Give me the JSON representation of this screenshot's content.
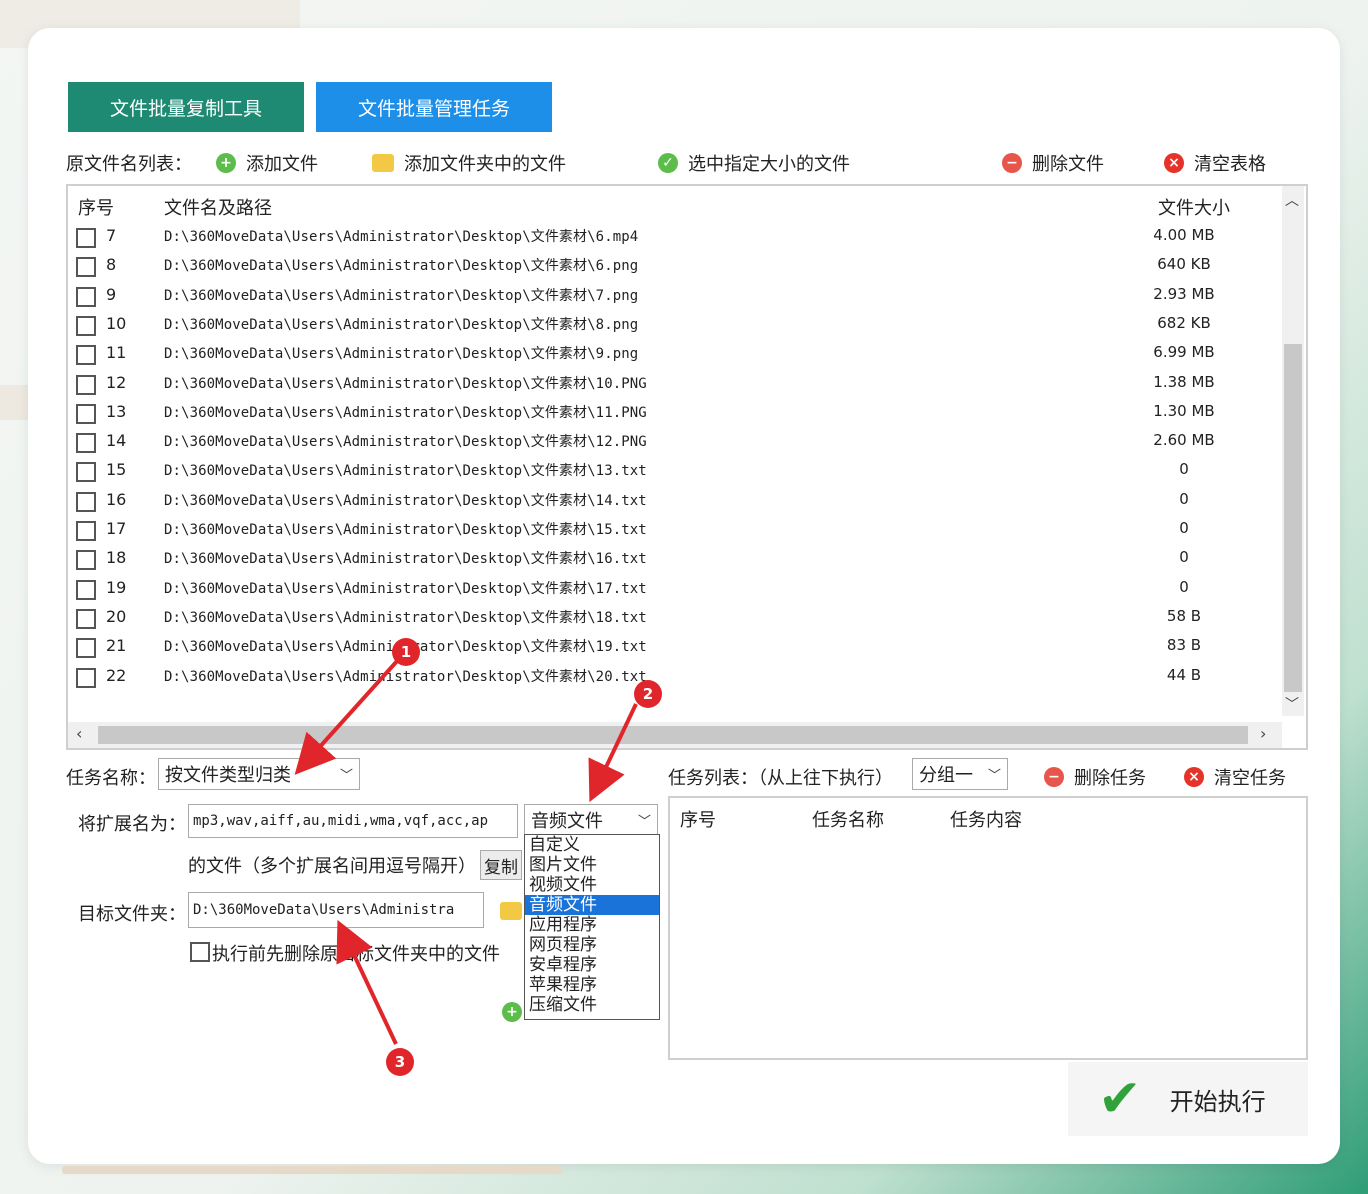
{
  "tabs": [
    "文件批量复制工具",
    "文件批量管理任务"
  ],
  "toolbar": {
    "label": "原文件名列表：",
    "add_file": "添加文件",
    "add_folder_files": "添加文件夹中的文件",
    "select_by_size": "选中指定大小的文件",
    "delete_file": "删除文件",
    "clear_table": "清空表格"
  },
  "file_table": {
    "headers": [
      "序号",
      "文件名及路径",
      "文件大小"
    ],
    "rows": [
      {
        "num": "7",
        "path": "D:\\360MoveData\\Users\\Administrator\\Desktop\\文件素材\\6.mp4",
        "size": "4.00 MB"
      },
      {
        "num": "8",
        "path": "D:\\360MoveData\\Users\\Administrator\\Desktop\\文件素材\\6.png",
        "size": "640 KB"
      },
      {
        "num": "9",
        "path": "D:\\360MoveData\\Users\\Administrator\\Desktop\\文件素材\\7.png",
        "size": "2.93 MB"
      },
      {
        "num": "10",
        "path": "D:\\360MoveData\\Users\\Administrator\\Desktop\\文件素材\\8.png",
        "size": "682 KB"
      },
      {
        "num": "11",
        "path": "D:\\360MoveData\\Users\\Administrator\\Desktop\\文件素材\\9.png",
        "size": "6.99 MB"
      },
      {
        "num": "12",
        "path": "D:\\360MoveData\\Users\\Administrator\\Desktop\\文件素材\\10.PNG",
        "size": "1.38 MB"
      },
      {
        "num": "13",
        "path": "D:\\360MoveData\\Users\\Administrator\\Desktop\\文件素材\\11.PNG",
        "size": "1.30 MB"
      },
      {
        "num": "14",
        "path": "D:\\360MoveData\\Users\\Administrator\\Desktop\\文件素材\\12.PNG",
        "size": "2.60 MB"
      },
      {
        "num": "15",
        "path": "D:\\360MoveData\\Users\\Administrator\\Desktop\\文件素材\\13.txt",
        "size": "0"
      },
      {
        "num": "16",
        "path": "D:\\360MoveData\\Users\\Administrator\\Desktop\\文件素材\\14.txt",
        "size": "0"
      },
      {
        "num": "17",
        "path": "D:\\360MoveData\\Users\\Administrator\\Desktop\\文件素材\\15.txt",
        "size": "0"
      },
      {
        "num": "18",
        "path": "D:\\360MoveData\\Users\\Administrator\\Desktop\\文件素材\\16.txt",
        "size": "0"
      },
      {
        "num": "19",
        "path": "D:\\360MoveData\\Users\\Administrator\\Desktop\\文件素材\\17.txt",
        "size": "0"
      },
      {
        "num": "20",
        "path": "D:\\360MoveData\\Users\\Administrator\\Desktop\\文件素材\\18.txt",
        "size": "58 B"
      },
      {
        "num": "21",
        "path": "D:\\360MoveData\\Users\\Administrator\\Desktop\\文件素材\\19.txt",
        "size": "83 B"
      },
      {
        "num": "22",
        "path": "D:\\360MoveData\\Users\\Administrator\\Desktop\\文件素材\\20.txt",
        "size": "44 B"
      }
    ]
  },
  "task_form": {
    "task_name_label": "任务名称：",
    "task_name_value": "按文件类型归类",
    "ext_label": "将扩展名为：",
    "ext_value": "mp3,wav,aiff,au,midi,wma,vqf,acc,ap",
    "file_type_value": "音频文件",
    "files_hint": "的文件（多个扩展名间用逗号隔开）",
    "copy_label": "复制",
    "target_label": "目标文件夹：",
    "target_value": "D:\\360MoveData\\Users\\Administra",
    "delete_before_label": "执行前先删除原目标文件夹中的文件",
    "file_type_options": [
      "自定义",
      "图片文件",
      "视频文件",
      "音频文件",
      "应用程序",
      "网页程序",
      "安卓程序",
      "苹果程序",
      "压缩文件"
    ]
  },
  "task_list": {
    "label": "任务列表：（从上往下执行）",
    "group_value": "分组一",
    "delete_task": "删除任务",
    "clear_task": "清空任务",
    "headers": [
      "序号",
      "任务名称",
      "任务内容"
    ]
  },
  "start_label": "开始执行",
  "annotations": [
    "1",
    "2",
    "3"
  ],
  "colors": {
    "tab1": "#1f8a73",
    "tab2": "#1e8fe8",
    "selection": "#1a73d8",
    "badge": "#e0262a"
  }
}
